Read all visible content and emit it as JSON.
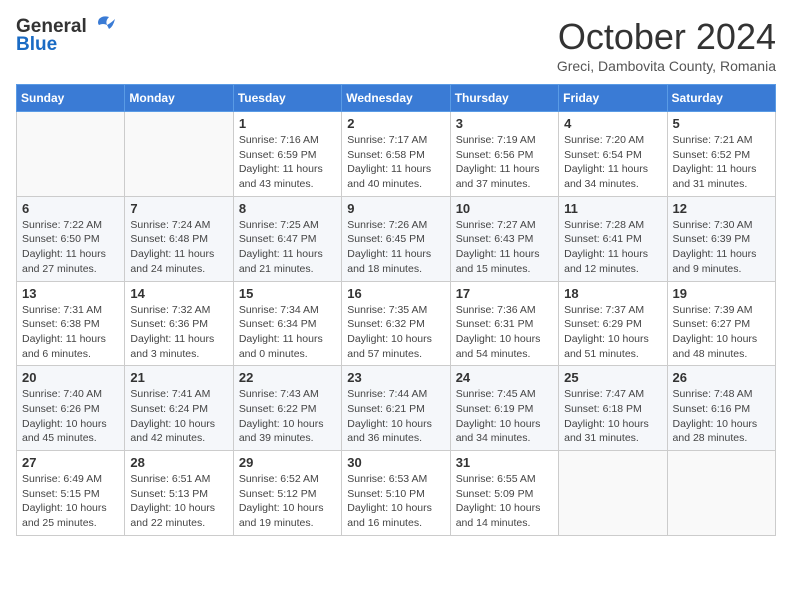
{
  "header": {
    "logo_general": "General",
    "logo_blue": "Blue",
    "month": "October 2024",
    "location": "Greci, Dambovita County, Romania"
  },
  "weekdays": [
    "Sunday",
    "Monday",
    "Tuesday",
    "Wednesday",
    "Thursday",
    "Friday",
    "Saturday"
  ],
  "weeks": [
    [
      {
        "day": "",
        "info": ""
      },
      {
        "day": "",
        "info": ""
      },
      {
        "day": "1",
        "info": "Sunrise: 7:16 AM\nSunset: 6:59 PM\nDaylight: 11 hours and 43 minutes."
      },
      {
        "day": "2",
        "info": "Sunrise: 7:17 AM\nSunset: 6:58 PM\nDaylight: 11 hours and 40 minutes."
      },
      {
        "day": "3",
        "info": "Sunrise: 7:19 AM\nSunset: 6:56 PM\nDaylight: 11 hours and 37 minutes."
      },
      {
        "day": "4",
        "info": "Sunrise: 7:20 AM\nSunset: 6:54 PM\nDaylight: 11 hours and 34 minutes."
      },
      {
        "day": "5",
        "info": "Sunrise: 7:21 AM\nSunset: 6:52 PM\nDaylight: 11 hours and 31 minutes."
      }
    ],
    [
      {
        "day": "6",
        "info": "Sunrise: 7:22 AM\nSunset: 6:50 PM\nDaylight: 11 hours and 27 minutes."
      },
      {
        "day": "7",
        "info": "Sunrise: 7:24 AM\nSunset: 6:48 PM\nDaylight: 11 hours and 24 minutes."
      },
      {
        "day": "8",
        "info": "Sunrise: 7:25 AM\nSunset: 6:47 PM\nDaylight: 11 hours and 21 minutes."
      },
      {
        "day": "9",
        "info": "Sunrise: 7:26 AM\nSunset: 6:45 PM\nDaylight: 11 hours and 18 minutes."
      },
      {
        "day": "10",
        "info": "Sunrise: 7:27 AM\nSunset: 6:43 PM\nDaylight: 11 hours and 15 minutes."
      },
      {
        "day": "11",
        "info": "Sunrise: 7:28 AM\nSunset: 6:41 PM\nDaylight: 11 hours and 12 minutes."
      },
      {
        "day": "12",
        "info": "Sunrise: 7:30 AM\nSunset: 6:39 PM\nDaylight: 11 hours and 9 minutes."
      }
    ],
    [
      {
        "day": "13",
        "info": "Sunrise: 7:31 AM\nSunset: 6:38 PM\nDaylight: 11 hours and 6 minutes."
      },
      {
        "day": "14",
        "info": "Sunrise: 7:32 AM\nSunset: 6:36 PM\nDaylight: 11 hours and 3 minutes."
      },
      {
        "day": "15",
        "info": "Sunrise: 7:34 AM\nSunset: 6:34 PM\nDaylight: 11 hours and 0 minutes."
      },
      {
        "day": "16",
        "info": "Sunrise: 7:35 AM\nSunset: 6:32 PM\nDaylight: 10 hours and 57 minutes."
      },
      {
        "day": "17",
        "info": "Sunrise: 7:36 AM\nSunset: 6:31 PM\nDaylight: 10 hours and 54 minutes."
      },
      {
        "day": "18",
        "info": "Sunrise: 7:37 AM\nSunset: 6:29 PM\nDaylight: 10 hours and 51 minutes."
      },
      {
        "day": "19",
        "info": "Sunrise: 7:39 AM\nSunset: 6:27 PM\nDaylight: 10 hours and 48 minutes."
      }
    ],
    [
      {
        "day": "20",
        "info": "Sunrise: 7:40 AM\nSunset: 6:26 PM\nDaylight: 10 hours and 45 minutes."
      },
      {
        "day": "21",
        "info": "Sunrise: 7:41 AM\nSunset: 6:24 PM\nDaylight: 10 hours and 42 minutes."
      },
      {
        "day": "22",
        "info": "Sunrise: 7:43 AM\nSunset: 6:22 PM\nDaylight: 10 hours and 39 minutes."
      },
      {
        "day": "23",
        "info": "Sunrise: 7:44 AM\nSunset: 6:21 PM\nDaylight: 10 hours and 36 minutes."
      },
      {
        "day": "24",
        "info": "Sunrise: 7:45 AM\nSunset: 6:19 PM\nDaylight: 10 hours and 34 minutes."
      },
      {
        "day": "25",
        "info": "Sunrise: 7:47 AM\nSunset: 6:18 PM\nDaylight: 10 hours and 31 minutes."
      },
      {
        "day": "26",
        "info": "Sunrise: 7:48 AM\nSunset: 6:16 PM\nDaylight: 10 hours and 28 minutes."
      }
    ],
    [
      {
        "day": "27",
        "info": "Sunrise: 6:49 AM\nSunset: 5:15 PM\nDaylight: 10 hours and 25 minutes."
      },
      {
        "day": "28",
        "info": "Sunrise: 6:51 AM\nSunset: 5:13 PM\nDaylight: 10 hours and 22 minutes."
      },
      {
        "day": "29",
        "info": "Sunrise: 6:52 AM\nSunset: 5:12 PM\nDaylight: 10 hours and 19 minutes."
      },
      {
        "day": "30",
        "info": "Sunrise: 6:53 AM\nSunset: 5:10 PM\nDaylight: 10 hours and 16 minutes."
      },
      {
        "day": "31",
        "info": "Sunrise: 6:55 AM\nSunset: 5:09 PM\nDaylight: 10 hours and 14 minutes."
      },
      {
        "day": "",
        "info": ""
      },
      {
        "day": "",
        "info": ""
      }
    ]
  ]
}
